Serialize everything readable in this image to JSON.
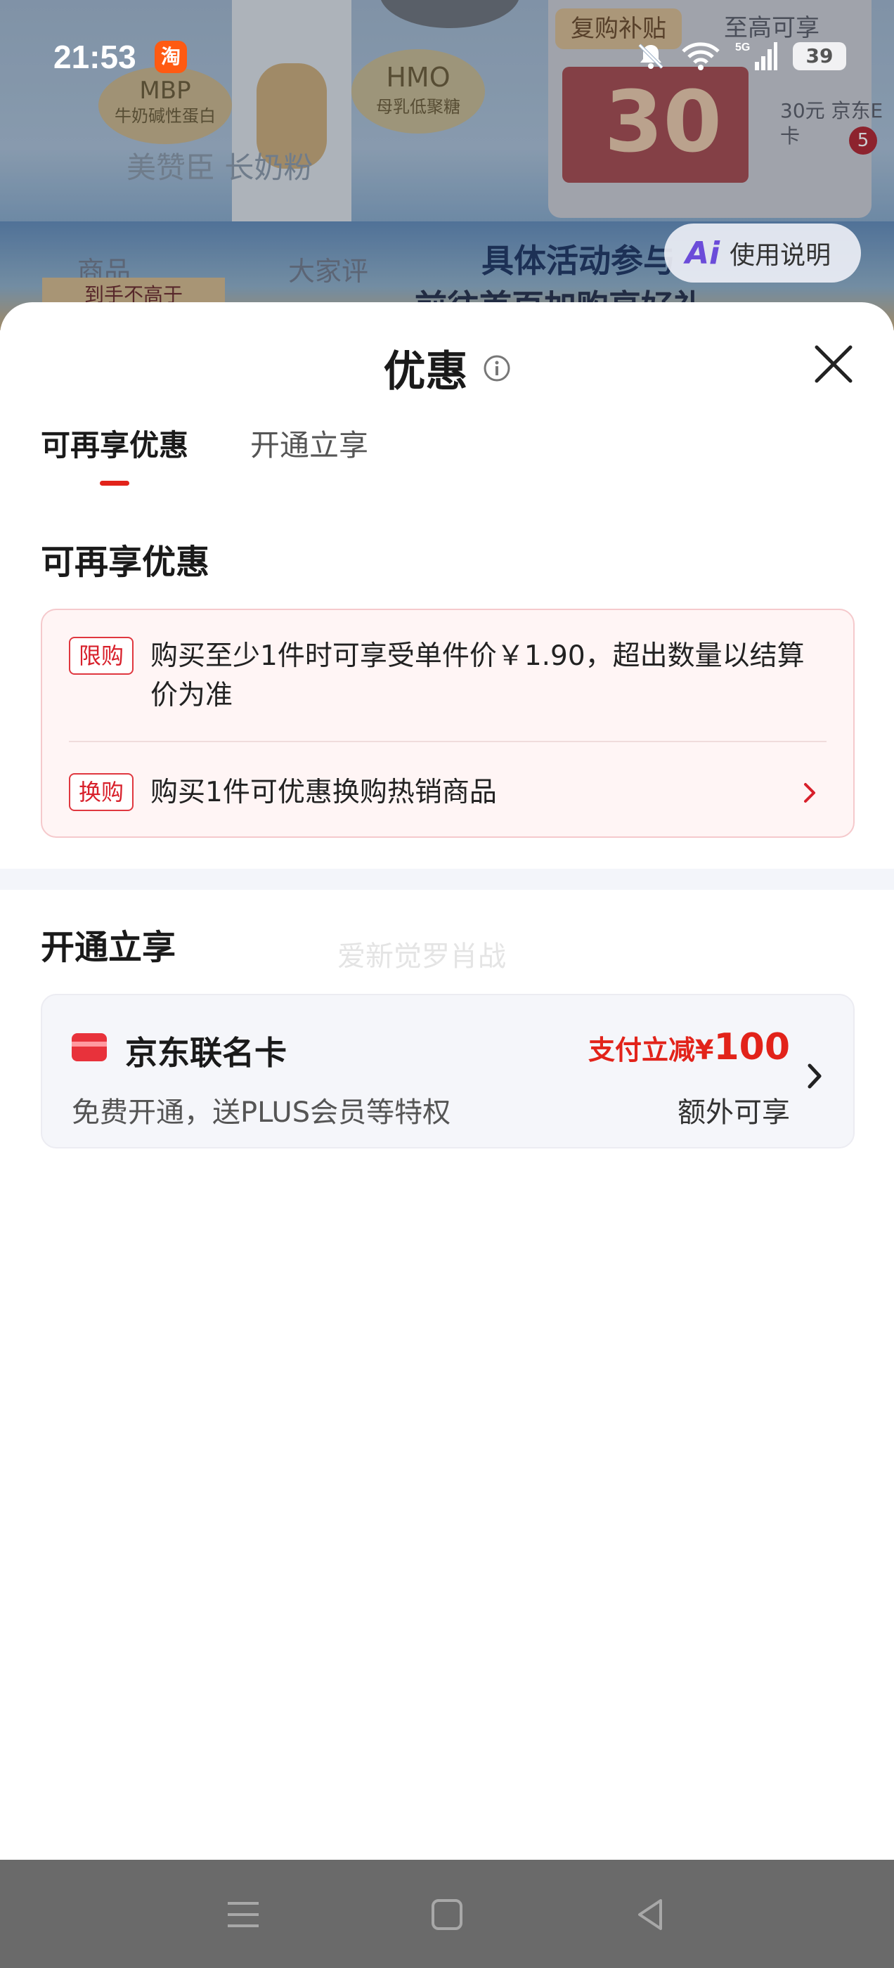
{
  "background": {
    "status_time": "21:53",
    "taobao_icon_text": "淘",
    "battery": "39",
    "badge_mbp": "MBP",
    "badge_mbp_sub": "牛奶碱性蛋白",
    "badge_hmo": "HMO",
    "badge_hmo_sub": "母乳低聚糖",
    "tag_fugou": "复购补贴",
    "tag_zhigao": "至高可享",
    "coupon_value": "30",
    "coupon_right_text": "30元 京东E卡",
    "notification_count": "5",
    "search_ghost": "美赞臣 长奶粉",
    "band_text_1": "具体活动参与",
    "band_text_2": "前往首页加购享好礼",
    "tab_ghost_1": "商品",
    "tab_ghost_2": "大家评",
    "strip_text": "到手不高于",
    "ai_button_label": "使用说明"
  },
  "sheet": {
    "title": "优惠",
    "tabs": [
      {
        "label": "可再享优惠",
        "active": true
      },
      {
        "label": "开通立享",
        "active": false
      }
    ],
    "section_reenjoy": {
      "title": "可再享优惠",
      "items": [
        {
          "tag": "限购",
          "text": "购买至少1件时可享受单件价￥1.90，超出数量以结算价为准"
        },
        {
          "tag": "换购",
          "text": "购买1件可优惠换购热销商品"
        }
      ]
    },
    "section_open": {
      "title": "开通立享",
      "watermark": "爱新觉罗肖战",
      "card": {
        "name": "京东联名卡",
        "desc": "免费开通，送PLUS会员等特权",
        "price_prefix": "支付立减¥",
        "price_value": "100",
        "extra": "额外可享"
      }
    }
  },
  "colors": {
    "accent_red": "#e2231a",
    "promo_bg": "#fff5f5",
    "card_bg": "#f5f6fa",
    "navbar_bg": "#6a6a6a"
  },
  "icons": [
    "info-icon",
    "close-icon",
    "chevron-right-icon",
    "card-icon",
    "menu-icon",
    "home-icon",
    "back-icon"
  ]
}
